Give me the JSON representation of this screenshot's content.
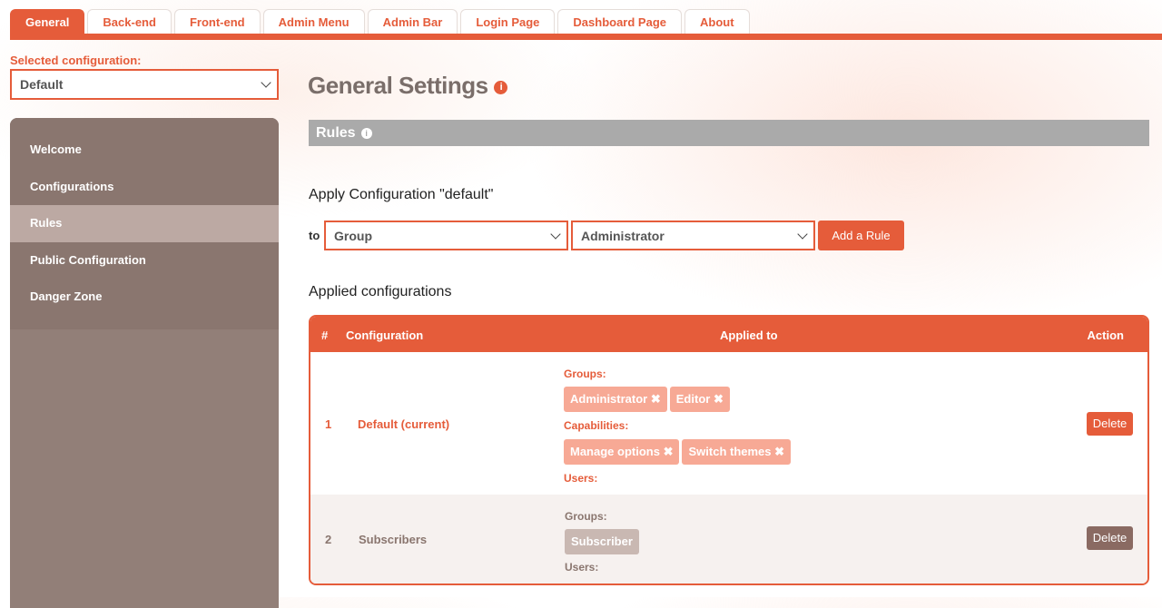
{
  "tabs": [
    "General",
    "Back-end",
    "Front-end",
    "Admin Menu",
    "Admin Bar",
    "Login Page",
    "Dashboard Page",
    "About"
  ],
  "selected_configuration": {
    "label": "Selected configuration:",
    "value": "Default"
  },
  "sidebar": {
    "items": [
      {
        "label": "Welcome"
      },
      {
        "label": "Configurations"
      },
      {
        "label": "Rules",
        "active": true
      },
      {
        "label": "Public Configuration"
      },
      {
        "label": "Danger Zone"
      }
    ]
  },
  "page_title": "General Settings",
  "rules_header": "Rules",
  "apply": {
    "title": "Apply Configuration \"default\"",
    "to_label": "to",
    "type_value": "Group",
    "target_value": "Administrator",
    "add_button": "Add a Rule"
  },
  "applied": {
    "title": "Applied configurations",
    "headers": {
      "num": "#",
      "configuration": "Configuration",
      "applied_to": "Applied to",
      "action": "Action"
    },
    "rows": [
      {
        "num": "1",
        "name": "Default (current)",
        "groups_label": "Groups:",
        "groups": [
          "Administrator",
          "Editor"
        ],
        "capabilities_label": "Capabilities:",
        "capabilities": [
          "Manage options",
          "Switch themes"
        ],
        "users_label": "Users:",
        "action": "Delete"
      },
      {
        "num": "2",
        "name": "Subscribers",
        "groups_label": "Groups:",
        "groups": [
          "Subscriber"
        ],
        "users_label": "Users:",
        "action": "Delete"
      }
    ]
  },
  "colors": {
    "accent": "#e55c3a",
    "sidebar": "#8a766f",
    "muted": "#aaaaaa"
  }
}
